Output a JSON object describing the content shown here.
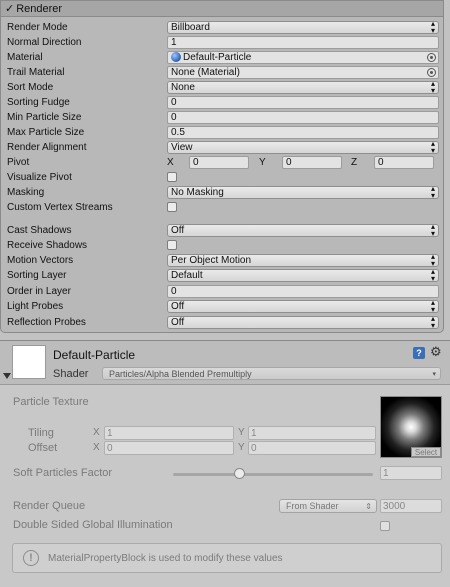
{
  "renderer": {
    "title": "Renderer",
    "props": {
      "render_mode": {
        "label": "Render Mode",
        "value": "Billboard"
      },
      "normal_direction": {
        "label": "Normal Direction",
        "value": "1"
      },
      "material": {
        "label": "Material",
        "value": "Default-Particle"
      },
      "trail_material": {
        "label": "Trail Material",
        "value": "None (Material)"
      },
      "sort_mode": {
        "label": "Sort Mode",
        "value": "None"
      },
      "sorting_fudge": {
        "label": "Sorting Fudge",
        "value": "0"
      },
      "min_particle_size": {
        "label": "Min Particle Size",
        "value": "0"
      },
      "max_particle_size": {
        "label": "Max Particle Size",
        "value": "0.5"
      },
      "render_alignment": {
        "label": "Render Alignment",
        "value": "View"
      },
      "pivot": {
        "label": "Pivot",
        "x_label": "X",
        "x": "0",
        "y_label": "Y",
        "y": "0",
        "z_label": "Z",
        "z": "0"
      },
      "visualize_pivot": {
        "label": "Visualize Pivot",
        "checked": false
      },
      "masking": {
        "label": "Masking",
        "value": "No Masking"
      },
      "custom_vertex_streams": {
        "label": "Custom Vertex Streams",
        "checked": false
      },
      "cast_shadows": {
        "label": "Cast Shadows",
        "value": "Off"
      },
      "receive_shadows": {
        "label": "Receive Shadows",
        "checked": false
      },
      "motion_vectors": {
        "label": "Motion Vectors",
        "value": "Per Object Motion"
      },
      "sorting_layer": {
        "label": "Sorting Layer",
        "value": "Default"
      },
      "order_in_layer": {
        "label": "Order in Layer",
        "value": "0"
      },
      "light_probes": {
        "label": "Light Probes",
        "value": "Off"
      },
      "reflection_probes": {
        "label": "Reflection Probes",
        "value": "Off"
      }
    }
  },
  "material": {
    "title": "Default-Particle",
    "shader_label": "Shader",
    "shader_value": "Particles/Alpha Blended Premultiply",
    "particle_texture_label": "Particle Texture",
    "tiling_label": "Tiling",
    "offset_label": "Offset",
    "tiling": {
      "x_label": "X",
      "x": "1",
      "y_label": "Y",
      "y": "1"
    },
    "offset": {
      "x_label": "X",
      "x": "0",
      "y_label": "Y",
      "y": "0"
    },
    "select_label": "Select",
    "soft_particles_label": "Soft Particles Factor",
    "soft_particles_value": "1",
    "soft_particles_slider_fraction": 0.33,
    "render_queue_label": "Render Queue",
    "render_queue_mode": "From Shader",
    "render_queue_value": "3000",
    "double_sided_gi_label": "Double Sided Global Illumination",
    "info_text": "MaterialPropertyBlock is used to modify these values"
  }
}
